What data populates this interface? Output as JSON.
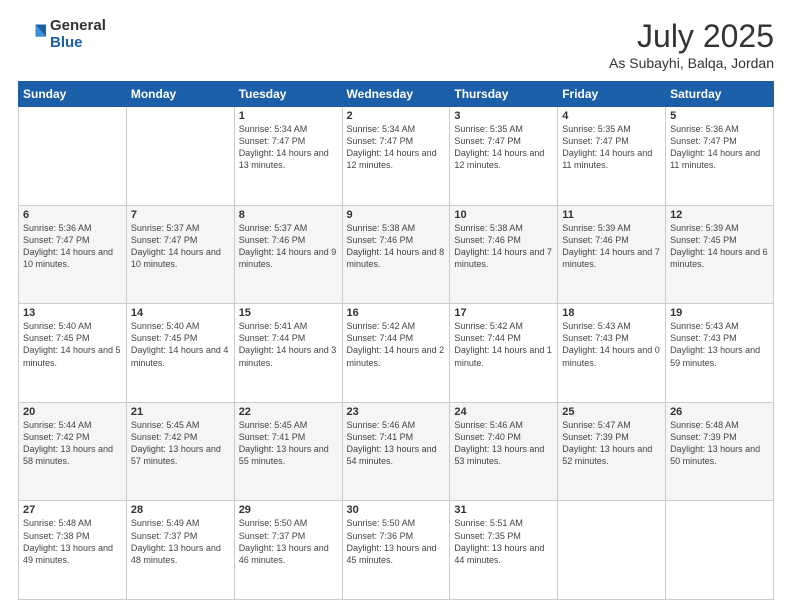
{
  "header": {
    "logo_general": "General",
    "logo_blue": "Blue",
    "title": "July 2025",
    "location": "As Subayhi, Balqa, Jordan"
  },
  "weekdays": [
    "Sunday",
    "Monday",
    "Tuesday",
    "Wednesday",
    "Thursday",
    "Friday",
    "Saturday"
  ],
  "weeks": [
    [
      {
        "day": "",
        "text": ""
      },
      {
        "day": "",
        "text": ""
      },
      {
        "day": "1",
        "text": "Sunrise: 5:34 AM\nSunset: 7:47 PM\nDaylight: 14 hours and 13 minutes."
      },
      {
        "day": "2",
        "text": "Sunrise: 5:34 AM\nSunset: 7:47 PM\nDaylight: 14 hours and 12 minutes."
      },
      {
        "day": "3",
        "text": "Sunrise: 5:35 AM\nSunset: 7:47 PM\nDaylight: 14 hours and 12 minutes."
      },
      {
        "day": "4",
        "text": "Sunrise: 5:35 AM\nSunset: 7:47 PM\nDaylight: 14 hours and 11 minutes."
      },
      {
        "day": "5",
        "text": "Sunrise: 5:36 AM\nSunset: 7:47 PM\nDaylight: 14 hours and 11 minutes."
      }
    ],
    [
      {
        "day": "6",
        "text": "Sunrise: 5:36 AM\nSunset: 7:47 PM\nDaylight: 14 hours and 10 minutes."
      },
      {
        "day": "7",
        "text": "Sunrise: 5:37 AM\nSunset: 7:47 PM\nDaylight: 14 hours and 10 minutes."
      },
      {
        "day": "8",
        "text": "Sunrise: 5:37 AM\nSunset: 7:46 PM\nDaylight: 14 hours and 9 minutes."
      },
      {
        "day": "9",
        "text": "Sunrise: 5:38 AM\nSunset: 7:46 PM\nDaylight: 14 hours and 8 minutes."
      },
      {
        "day": "10",
        "text": "Sunrise: 5:38 AM\nSunset: 7:46 PM\nDaylight: 14 hours and 7 minutes."
      },
      {
        "day": "11",
        "text": "Sunrise: 5:39 AM\nSunset: 7:46 PM\nDaylight: 14 hours and 7 minutes."
      },
      {
        "day": "12",
        "text": "Sunrise: 5:39 AM\nSunset: 7:45 PM\nDaylight: 14 hours and 6 minutes."
      }
    ],
    [
      {
        "day": "13",
        "text": "Sunrise: 5:40 AM\nSunset: 7:45 PM\nDaylight: 14 hours and 5 minutes."
      },
      {
        "day": "14",
        "text": "Sunrise: 5:40 AM\nSunset: 7:45 PM\nDaylight: 14 hours and 4 minutes."
      },
      {
        "day": "15",
        "text": "Sunrise: 5:41 AM\nSunset: 7:44 PM\nDaylight: 14 hours and 3 minutes."
      },
      {
        "day": "16",
        "text": "Sunrise: 5:42 AM\nSunset: 7:44 PM\nDaylight: 14 hours and 2 minutes."
      },
      {
        "day": "17",
        "text": "Sunrise: 5:42 AM\nSunset: 7:44 PM\nDaylight: 14 hours and 1 minute."
      },
      {
        "day": "18",
        "text": "Sunrise: 5:43 AM\nSunset: 7:43 PM\nDaylight: 14 hours and 0 minutes."
      },
      {
        "day": "19",
        "text": "Sunrise: 5:43 AM\nSunset: 7:43 PM\nDaylight: 13 hours and 59 minutes."
      }
    ],
    [
      {
        "day": "20",
        "text": "Sunrise: 5:44 AM\nSunset: 7:42 PM\nDaylight: 13 hours and 58 minutes."
      },
      {
        "day": "21",
        "text": "Sunrise: 5:45 AM\nSunset: 7:42 PM\nDaylight: 13 hours and 57 minutes."
      },
      {
        "day": "22",
        "text": "Sunrise: 5:45 AM\nSunset: 7:41 PM\nDaylight: 13 hours and 55 minutes."
      },
      {
        "day": "23",
        "text": "Sunrise: 5:46 AM\nSunset: 7:41 PM\nDaylight: 13 hours and 54 minutes."
      },
      {
        "day": "24",
        "text": "Sunrise: 5:46 AM\nSunset: 7:40 PM\nDaylight: 13 hours and 53 minutes."
      },
      {
        "day": "25",
        "text": "Sunrise: 5:47 AM\nSunset: 7:39 PM\nDaylight: 13 hours and 52 minutes."
      },
      {
        "day": "26",
        "text": "Sunrise: 5:48 AM\nSunset: 7:39 PM\nDaylight: 13 hours and 50 minutes."
      }
    ],
    [
      {
        "day": "27",
        "text": "Sunrise: 5:48 AM\nSunset: 7:38 PM\nDaylight: 13 hours and 49 minutes."
      },
      {
        "day": "28",
        "text": "Sunrise: 5:49 AM\nSunset: 7:37 PM\nDaylight: 13 hours and 48 minutes."
      },
      {
        "day": "29",
        "text": "Sunrise: 5:50 AM\nSunset: 7:37 PM\nDaylight: 13 hours and 46 minutes."
      },
      {
        "day": "30",
        "text": "Sunrise: 5:50 AM\nSunset: 7:36 PM\nDaylight: 13 hours and 45 minutes."
      },
      {
        "day": "31",
        "text": "Sunrise: 5:51 AM\nSunset: 7:35 PM\nDaylight: 13 hours and 44 minutes."
      },
      {
        "day": "",
        "text": ""
      },
      {
        "day": "",
        "text": ""
      }
    ]
  ]
}
